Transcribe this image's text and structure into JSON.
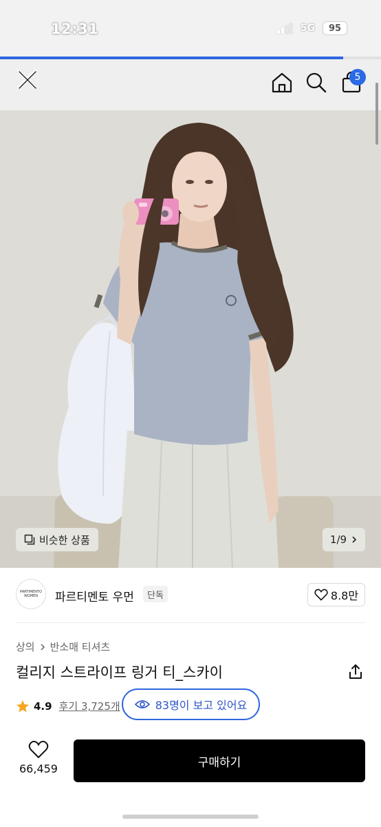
{
  "status_bar": {
    "time": "12:31",
    "network": "5G",
    "battery": "95"
  },
  "page_load": {
    "progress": 0.9
  },
  "header": {
    "close_icon": "close-icon",
    "home_icon": "home-icon",
    "search_icon": "search-icon",
    "cart_icon": "shopping-bag-icon",
    "cart_count": "5"
  },
  "gallery": {
    "similar_label": "비슷한 상품",
    "current_index": "1/9"
  },
  "brand": {
    "logo_line1": "PARTIMENTO",
    "logo_line2": "WOMEN",
    "name": "파르티멘토 우먼",
    "tag": "단독",
    "likes": "8.8만"
  },
  "product": {
    "breadcrumb": [
      "상의",
      "반소매 티셔츠"
    ],
    "title": "컬리지 스트라이프 링거 티_스카이",
    "rating": "4.9",
    "reviews": "후기 3,725개",
    "viewers": "83명이 보고 있어요"
  },
  "bottom_bar": {
    "wish_count": "66,459",
    "buy_label": "구매하기"
  },
  "colors": {
    "accent": "#2f66e0",
    "buy_button": "#000000",
    "star": "#f5a623"
  }
}
